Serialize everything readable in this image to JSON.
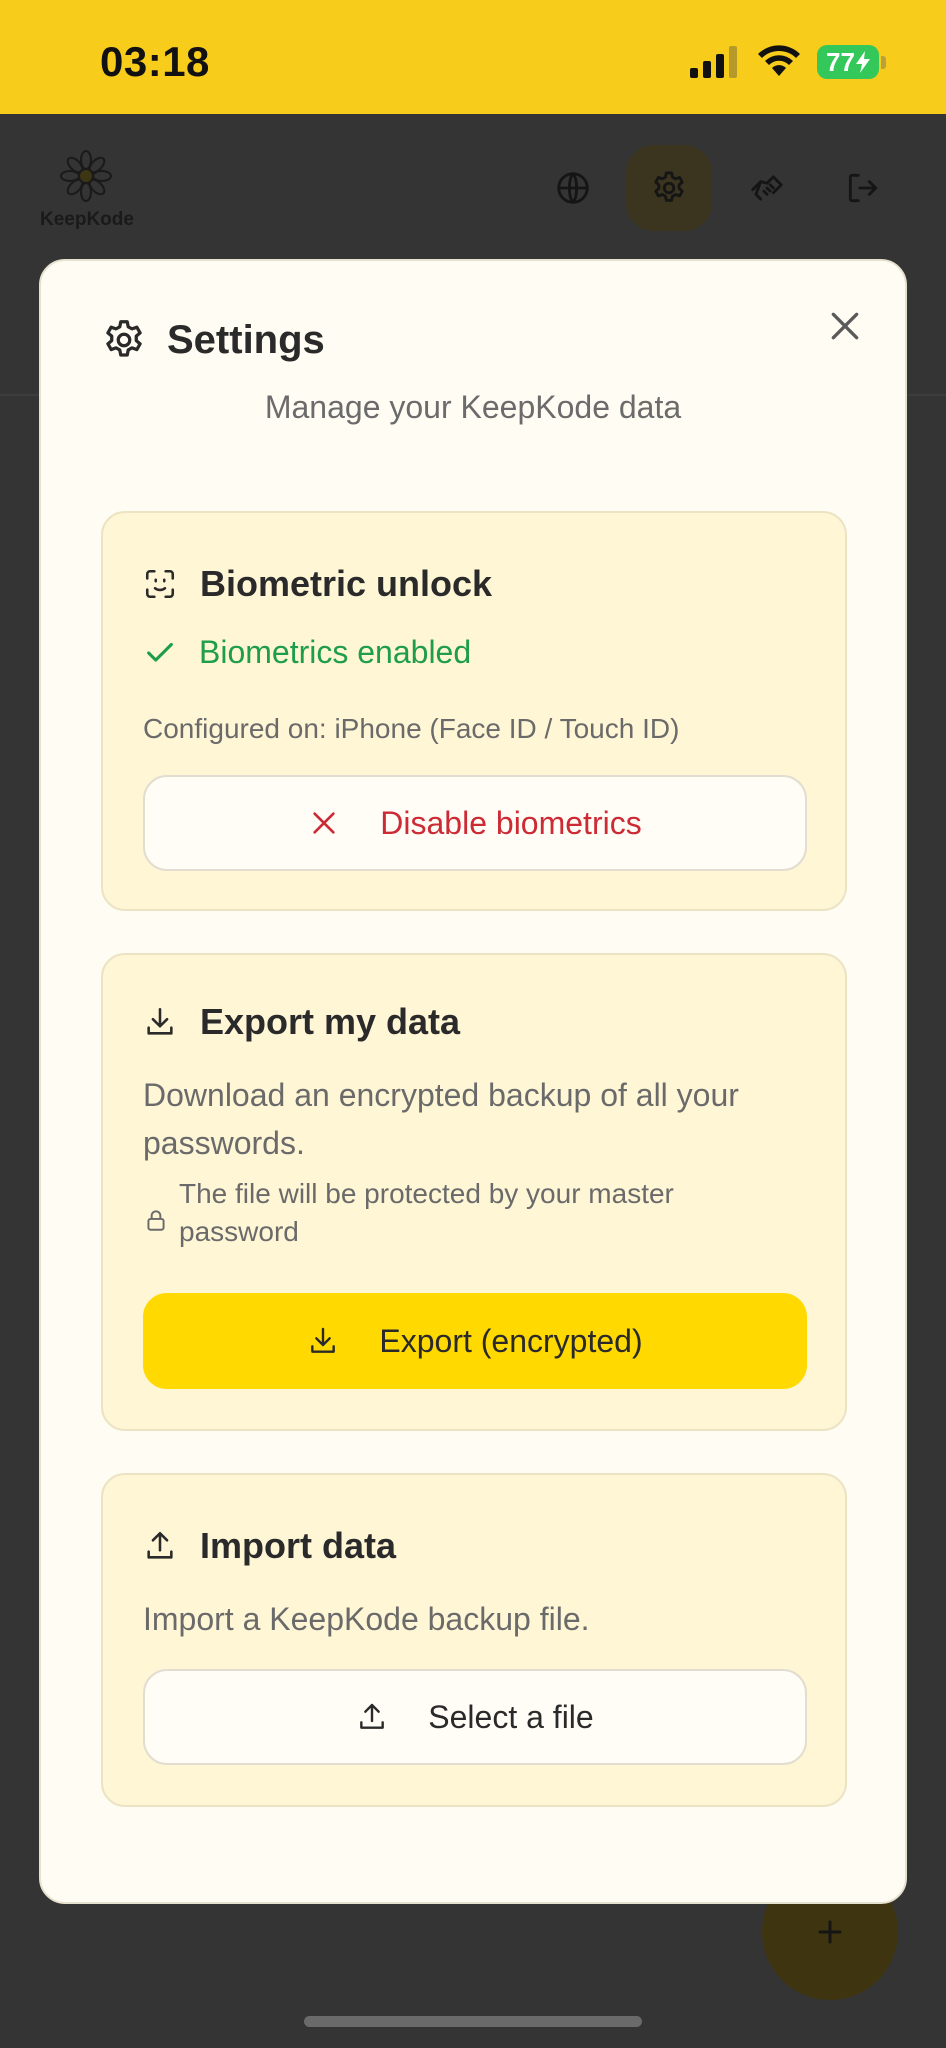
{
  "status_bar": {
    "time": "03:18",
    "battery": "77",
    "battery_color": "#34c759",
    "background": "#f8cc1b"
  },
  "app_header": {
    "logo_text": "KeepKode",
    "icons": [
      "globe-icon",
      "gear-icon",
      "handshake-icon",
      "logout-icon"
    ],
    "active_icon": "gear-icon"
  },
  "modal": {
    "title": "Settings",
    "subtitle": "Manage your KeepKode data",
    "close_icon": "close-icon"
  },
  "biometric": {
    "title": "Biometric unlock",
    "status": "Biometrics enabled",
    "configured": "Configured on: iPhone (Face ID / Touch ID)",
    "button_label": "Disable biometrics",
    "status_color": "#1e9e4a",
    "danger_color": "#cc2b36"
  },
  "export": {
    "title": "Export my data",
    "description": "Download an encrypted backup of all your passwords.",
    "note": "The file will be protected by your master password",
    "button_label": "Export (encrypted)",
    "button_color": "#ffd900"
  },
  "import": {
    "title": "Import data",
    "description": "Import a KeepKode backup file.",
    "button_label": "Select a file"
  }
}
